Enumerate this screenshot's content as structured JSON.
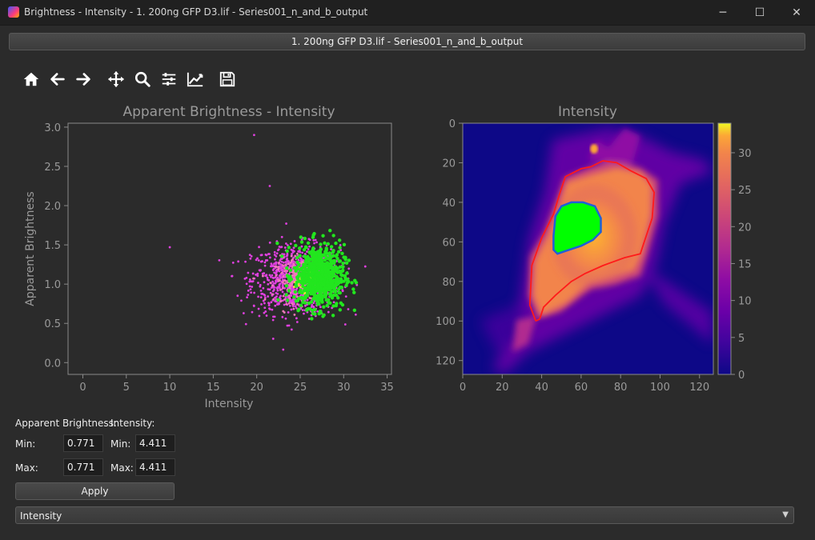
{
  "window": {
    "title": "Brightness - Intensity - 1. 200ng GFP D3.lif - Series001_n_and_b_output",
    "minimize": "─",
    "maximize": "☐",
    "close": "✕"
  },
  "tab": {
    "label": "1. 200ng GFP D3.lif - Series001_n_and_b_output"
  },
  "toolbar": {
    "icons": [
      "home-icon",
      "back-arrow-icon",
      "forward-arrow-icon",
      "pan-icon",
      "zoom-icon",
      "configure-subplots-icon",
      "edit-axis-icon",
      "save-icon"
    ]
  },
  "scatter": {
    "title": "Apparent Brightness - Intensity",
    "xlabel": "Intensity",
    "ylabel": "Apparent Brightness",
    "xticks": [
      "0",
      "5",
      "10",
      "15",
      "20",
      "25",
      "30",
      "35"
    ],
    "yticks": [
      "0.0",
      "0.5",
      "1.0",
      "1.5",
      "2.0",
      "2.5",
      "3.0"
    ]
  },
  "image": {
    "title": "Intensity",
    "xticks": [
      "0",
      "20",
      "40",
      "60",
      "80",
      "100",
      "120"
    ],
    "yticks": [
      "0",
      "20",
      "40",
      "60",
      "80",
      "100",
      "120"
    ],
    "cticks": [
      "0",
      "5",
      "10",
      "15",
      "20",
      "25",
      "30"
    ]
  },
  "chart_data": [
    {
      "type": "scatter",
      "title": "Apparent Brightness - Intensity",
      "xlabel": "Intensity",
      "ylabel": "Apparent Brightness",
      "xlim": [
        -1.7,
        35.5
      ],
      "ylim": [
        -0.15,
        3.05
      ],
      "grid": false,
      "series": [
        {
          "color": "#e040e0",
          "center": [
            24.5,
            1.05
          ],
          "spread": [
            4.6,
            0.22
          ],
          "count": 900
        },
        {
          "color": "#f07ab8",
          "center": [
            25.0,
            1.05
          ],
          "spread": [
            2.6,
            0.14
          ],
          "count": 260
        },
        {
          "color": "#ffe23a",
          "center": [
            25.5,
            1.05
          ],
          "spread": [
            1.1,
            0.07
          ],
          "count": 60
        },
        {
          "color": "#22e61e",
          "center": [
            27.2,
            1.1
          ],
          "spread": [
            2.6,
            0.2
          ],
          "count": 700
        }
      ],
      "outliers": [
        [
          19.7,
          2.9
        ],
        [
          21.5,
          2.25
        ],
        [
          10.0,
          1.47
        ],
        [
          18.5,
          0.63
        ]
      ]
    },
    {
      "type": "heatmap",
      "title": "Intensity",
      "xlim": [
        0,
        127
      ],
      "ylim": [
        127,
        0
      ],
      "colorbar": {
        "min": 0,
        "max": 34,
        "ticks": [
          0,
          5,
          10,
          15,
          20,
          25,
          30
        ],
        "colormap": "plasma"
      },
      "outlines": [
        {
          "color": "#ff1a1a",
          "points": [
            [
              37,
              100
            ],
            [
              34,
              92
            ],
            [
              35,
              72
            ],
            [
              40,
              58
            ],
            [
              46,
              46
            ],
            [
              49,
              36
            ],
            [
              52,
              27
            ],
            [
              60,
              23
            ],
            [
              65,
              22
            ],
            [
              71,
              19
            ],
            [
              78,
              20
            ],
            [
              85,
              24
            ],
            [
              93,
              28
            ],
            [
              97,
              35
            ],
            [
              96,
              48
            ],
            [
              92,
              60
            ],
            [
              90,
              66
            ],
            [
              82,
              68
            ],
            [
              71,
              72
            ],
            [
              62,
              76
            ],
            [
              55,
              80
            ],
            [
              47,
              87
            ],
            [
              41,
              93
            ],
            [
              39,
              99
            ]
          ]
        },
        {
          "color": "#1f5fd8",
          "points": [
            [
              46,
              64
            ],
            [
              46,
              57
            ],
            [
              47,
              47
            ],
            [
              50,
              42
            ],
            [
              55,
              40
            ],
            [
              61,
              40
            ],
            [
              67,
              42
            ],
            [
              70,
              48
            ],
            [
              70,
              55
            ],
            [
              66,
              59
            ],
            [
              60,
              62
            ],
            [
              54,
              64
            ],
            [
              48,
              66
            ]
          ]
        }
      ]
    }
  ]
}
